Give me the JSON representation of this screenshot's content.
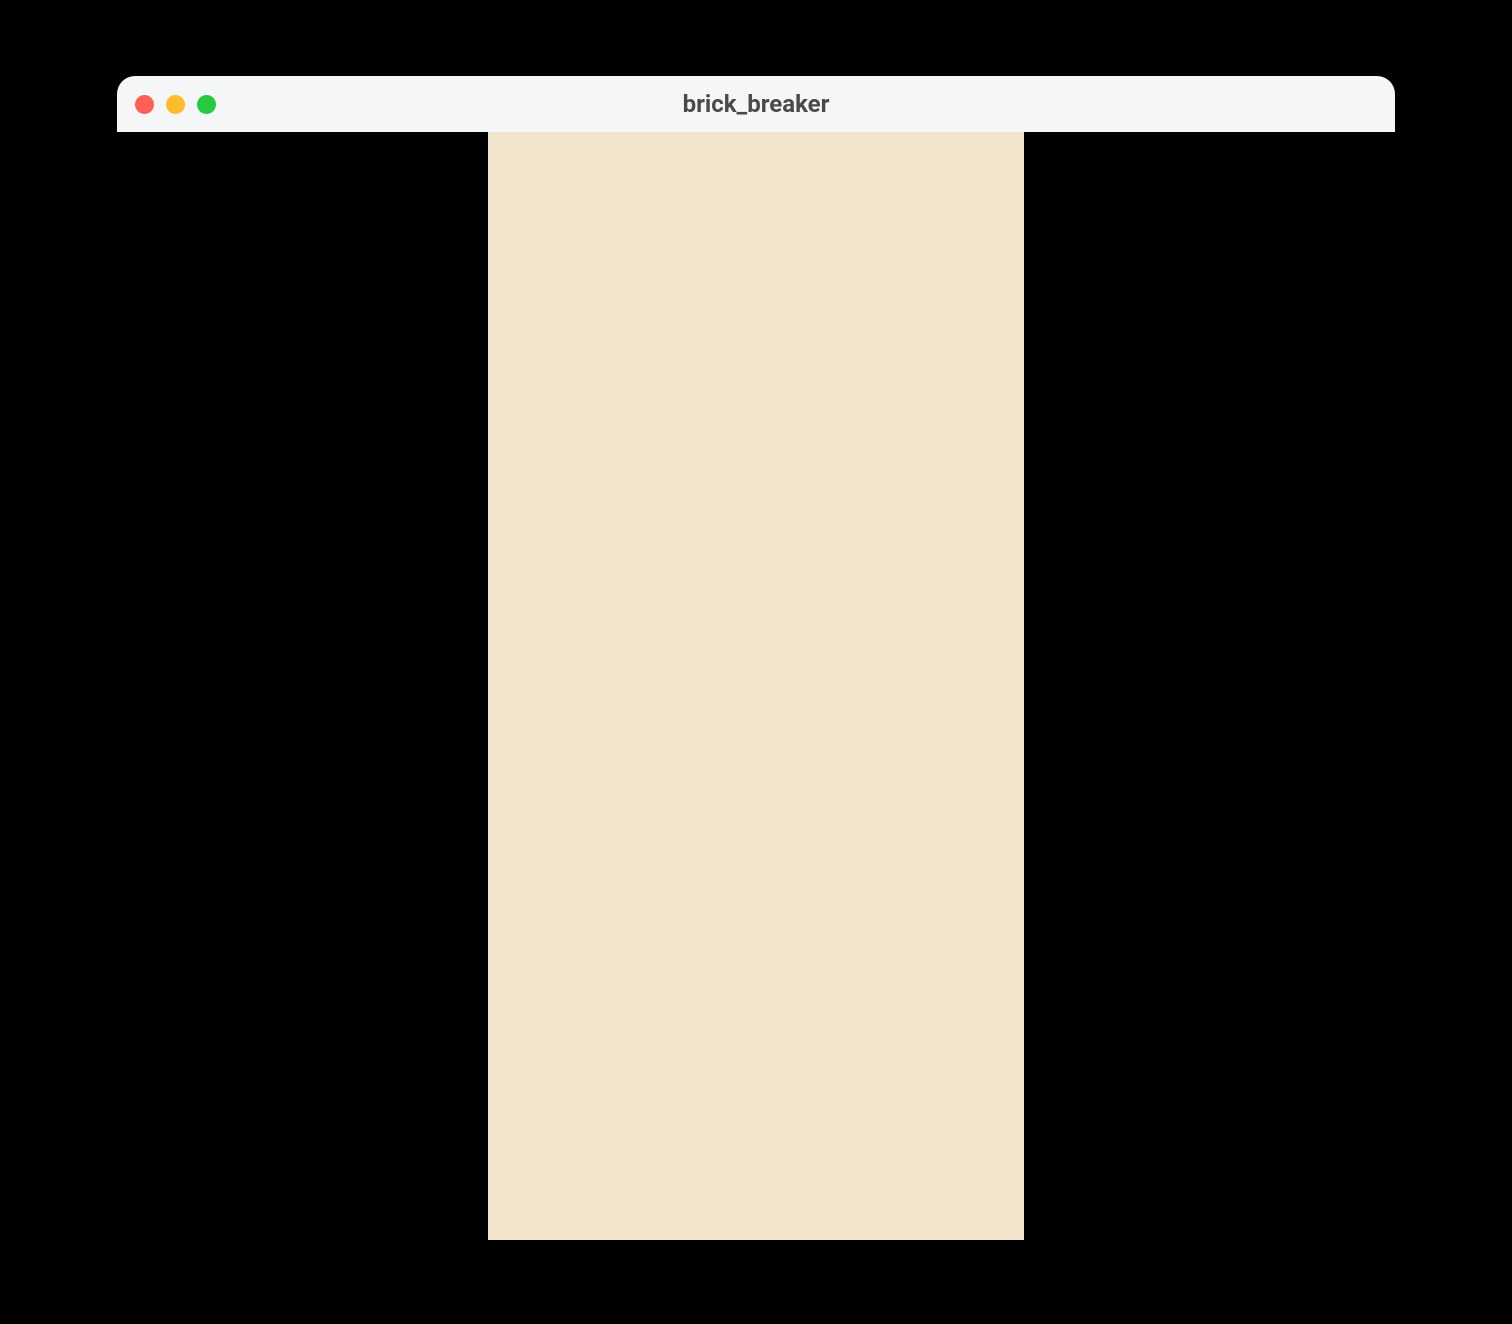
{
  "window": {
    "title": "brick_breaker"
  },
  "traffic_lights": {
    "close_color": "#ff5f57",
    "minimize_color": "#febc2e",
    "zoom_color": "#28c840"
  },
  "game": {
    "canvas_color": "#f1e6cc",
    "background_color": "#000000"
  }
}
